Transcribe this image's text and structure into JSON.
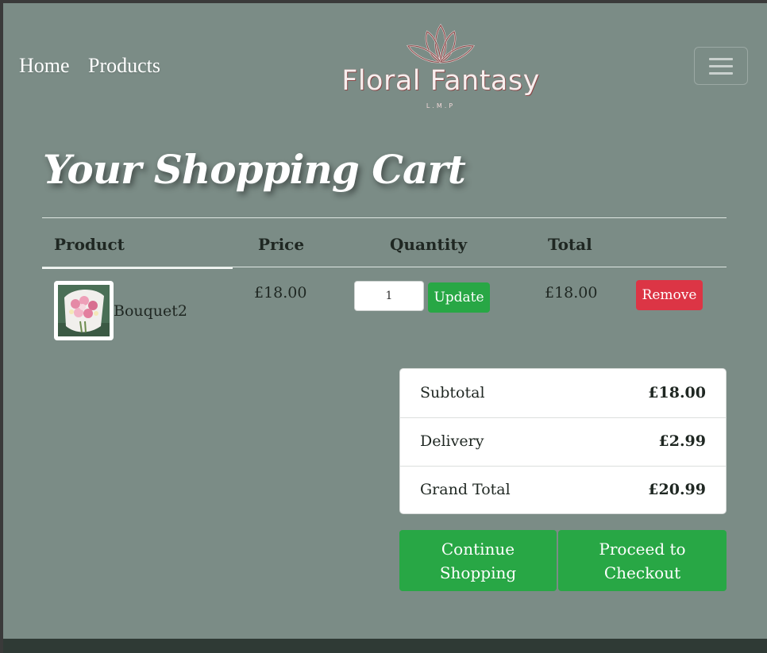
{
  "nav": {
    "home": "Home",
    "products": "Products"
  },
  "brand": {
    "name": "Floral Fantasy",
    "sub": "L.M.P",
    "icon": "lotus-logo"
  },
  "menu_icon": "hamburger-icon",
  "page": {
    "title": "Your Shopping Cart"
  },
  "table": {
    "headers": [
      "Product",
      "Price",
      "Quantity",
      "Total"
    ],
    "rows": [
      {
        "name": "Bouquet2",
        "price": "£18.00",
        "quantity": "1",
        "total": "£18.00",
        "update_label": "Update",
        "remove_label": "Remove"
      }
    ]
  },
  "summary": {
    "subtotal_label": "Subtotal",
    "subtotal_value": "£18.00",
    "delivery_label": "Delivery",
    "delivery_value": "£2.99",
    "grand_label": "Grand Total",
    "grand_value": "£20.99"
  },
  "actions": {
    "continue_line1": "Continue",
    "continue_line2": "Shopping",
    "checkout_line1": "Proceed to",
    "checkout_line2": "Checkout"
  },
  "colors": {
    "background": "#7b8c86",
    "primary_button": "#28a745",
    "danger_button": "#dc3545",
    "footer": "#2f3a35"
  }
}
